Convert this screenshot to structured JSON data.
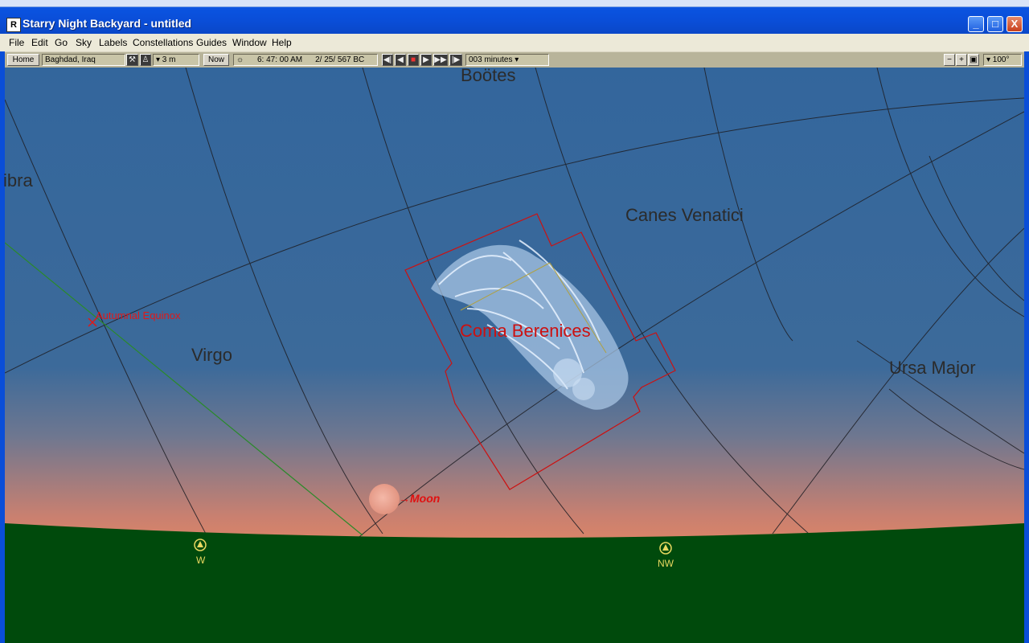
{
  "window": {
    "title": "Starry Night Backyard - untitled",
    "app_icon_glyph": "R",
    "minimize_glyph": "_",
    "maximize_glyph": "□",
    "close_glyph": "X"
  },
  "menu": [
    "File",
    "Edit",
    "Go",
    "Sky",
    "Labels",
    "Constellations",
    "Guides",
    "Window",
    "Help"
  ],
  "toolbar": {
    "home_label": "Home",
    "location": "Baghdad, Iraq",
    "elevation": "▾ 3 m",
    "now_label": "Now",
    "time": "6: 47: 00 AM",
    "date": "2/ 25/  567 BC",
    "time_step": "003 minutes ▾",
    "field_of_view": "▾ 100°",
    "step_back_glyph": "◀|",
    "reverse_glyph": "◀",
    "stop_glyph": "■",
    "play_glyph": "▶",
    "forward_glyph": "▶▶",
    "step_forward_glyph": "|▶",
    "zoom_out_glyph": "−",
    "zoom_in_glyph": "+",
    "zoom_fit_glyph": "▣"
  },
  "sky": {
    "constellation_labels": [
      "Boötes",
      "ibra",
      "Canes Venatici",
      "Virgo",
      "Ursa Major"
    ],
    "selected_constellation": "Coma Berenices",
    "equinox_label": "Autumnal Equinox",
    "moon_label": "Moon",
    "directions": [
      "W",
      "NW"
    ],
    "colors": {
      "sky_top": "#33669c",
      "horizon_glow": "#f08a5c",
      "ground": "#004a0c",
      "selected": "#cc1111",
      "compass": "#e8d860"
    }
  }
}
